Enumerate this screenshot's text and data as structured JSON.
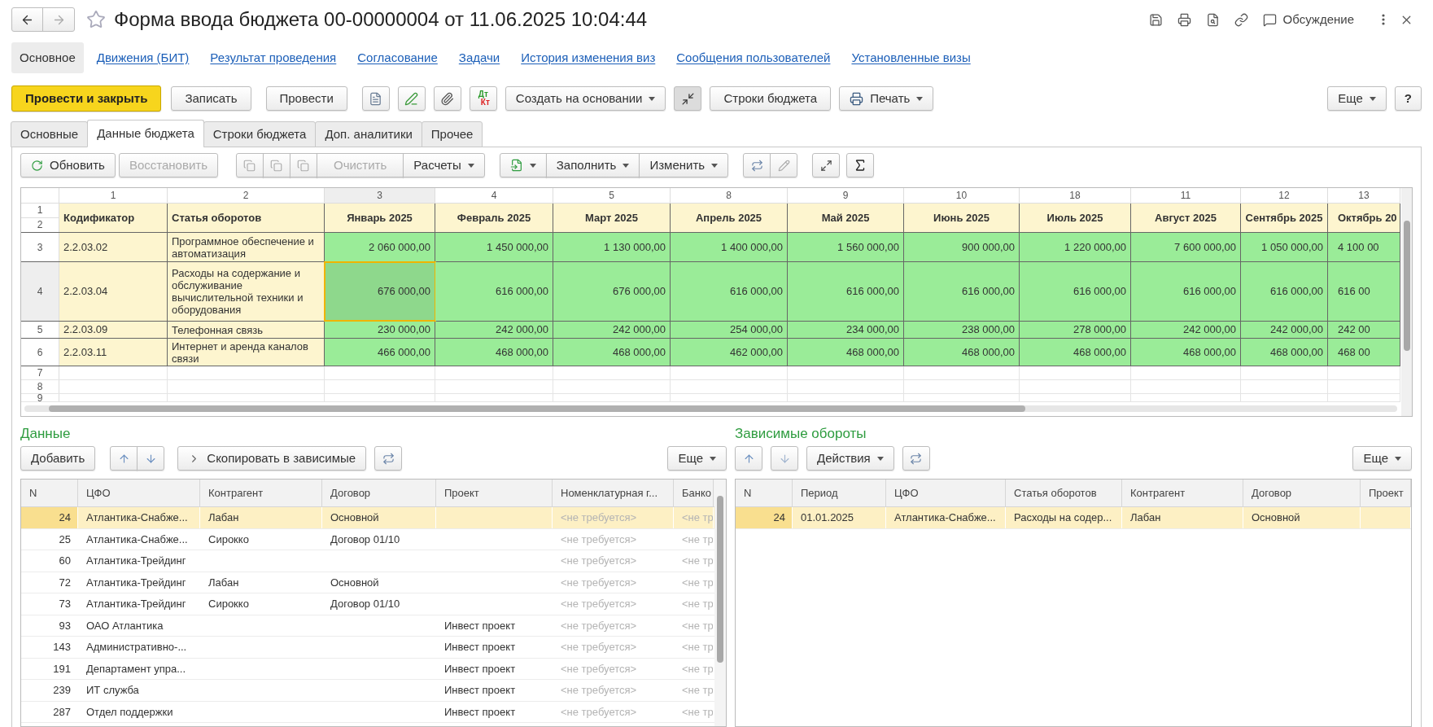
{
  "window": {
    "title": "Форма ввода бюджета 00-00000004 от 11.06.2025 10:04:44",
    "discussion": "Обсуждение"
  },
  "nav_links": [
    {
      "label": "Основное",
      "selected": true
    },
    {
      "label": "Движения (БИТ)",
      "selected": false
    },
    {
      "label": "Результат проведения",
      "selected": false
    },
    {
      "label": "Согласование",
      "selected": false
    },
    {
      "label": "Задачи",
      "selected": false
    },
    {
      "label": "История изменения виз",
      "selected": false
    },
    {
      "label": "Сообщения пользователей",
      "selected": false
    },
    {
      "label": "Установленные визы",
      "selected": false
    }
  ],
  "command_bar": {
    "post_close": "Провести и закрыть",
    "save": "Записать",
    "post": "Провести",
    "debit": "Дт",
    "credit": "Кт",
    "create_based": "Создать на основании",
    "compact_on": true,
    "budget_rows": "Строки бюджета",
    "print": "Печать",
    "more": "Еще",
    "help": "?"
  },
  "tabs": [
    {
      "label": "Основные",
      "selected": false
    },
    {
      "label": "Данные бюджета",
      "selected": true
    },
    {
      "label": "Строки бюджета",
      "selected": false
    },
    {
      "label": "Доп. аналитики",
      "selected": false
    },
    {
      "label": "Прочее",
      "selected": false
    }
  ],
  "sheet_toolbar": {
    "refresh": {
      "label": "Обновить",
      "disabled": false
    },
    "restore": {
      "label": "Восстановить",
      "disabled": true
    },
    "clear": {
      "label": "Очистить",
      "disabled": true
    },
    "calculations": "Расчеты",
    "fill": "Заполнить",
    "change": "Изменить"
  },
  "spreadsheet": {
    "column_numbers": [
      "1",
      "2",
      "3",
      "4",
      "5",
      "8",
      "9",
      "10",
      "18",
      "11",
      "12",
      "13"
    ],
    "header_row_numbers": [
      "1",
      "2"
    ],
    "headers": [
      "Кодификатор",
      "Статья оборотов",
      "Январь 2025",
      "Февраль 2025",
      "Март 2025",
      "Апрель 2025",
      "Май 2025",
      "Июнь 2025",
      "Июль 2025",
      "Август 2025",
      "Сентябрь 2025",
      "Октябрь 20"
    ],
    "rows": [
      {
        "number": "3",
        "code": "2.2.03.02",
        "item": "Программное обеспечение и автоматизация",
        "values": [
          {
            "text": "2 060 000,00",
            "selected": false
          },
          {
            "text": "1 450 000,00",
            "selected": false
          },
          {
            "text": "1 130 000,00",
            "selected": false
          },
          {
            "text": "1 400 000,00",
            "selected": false
          },
          {
            "text": "1 560 000,00",
            "selected": false
          },
          {
            "text": "900 000,00",
            "selected": false
          },
          {
            "text": "1 220 000,00",
            "selected": false
          },
          {
            "text": "7 600 000,00",
            "selected": false
          },
          {
            "text": "1 050 000,00",
            "selected": false
          },
          {
            "text": "4 100 00",
            "selected": false
          }
        ]
      },
      {
        "number": "4",
        "code": "2.2.03.04",
        "item": "Расходы на содержание и обслуживание вычислительной техники и оборудования",
        "values": [
          {
            "text": "676 000,00",
            "selected": true
          },
          {
            "text": "616 000,00",
            "selected": false
          },
          {
            "text": "676 000,00",
            "selected": false
          },
          {
            "text": "616 000,00",
            "selected": false
          },
          {
            "text": "616 000,00",
            "selected": false
          },
          {
            "text": "616 000,00",
            "selected": false
          },
          {
            "text": "616 000,00",
            "selected": false
          },
          {
            "text": "616 000,00",
            "selected": false
          },
          {
            "text": "616 000,00",
            "selected": false
          },
          {
            "text": "616 00",
            "selected": false
          }
        ]
      },
      {
        "number": "5",
        "code": "2.2.03.09",
        "item": "Телефонная связь",
        "values": [
          {
            "text": "230 000,00",
            "selected": false
          },
          {
            "text": "242 000,00",
            "selected": false
          },
          {
            "text": "242 000,00",
            "selected": false
          },
          {
            "text": "254 000,00",
            "selected": false
          },
          {
            "text": "234 000,00",
            "selected": false
          },
          {
            "text": "238 000,00",
            "selected": false
          },
          {
            "text": "278 000,00",
            "selected": false
          },
          {
            "text": "242 000,00",
            "selected": false
          },
          {
            "text": "242 000,00",
            "selected": false
          },
          {
            "text": "242 00",
            "selected": false
          }
        ]
      },
      {
        "number": "6",
        "code": "2.2.03.11",
        "item": "Интернет и аренда каналов связи",
        "values": [
          {
            "text": "466 000,00",
            "selected": false
          },
          {
            "text": "468 000,00",
            "selected": false
          },
          {
            "text": "468 000,00",
            "selected": false
          },
          {
            "text": "462 000,00",
            "selected": false
          },
          {
            "text": "468 000,00",
            "selected": false
          },
          {
            "text": "468 000,00",
            "selected": false
          },
          {
            "text": "468 000,00",
            "selected": false
          },
          {
            "text": "468 000,00",
            "selected": false
          },
          {
            "text": "468 000,00",
            "selected": false
          },
          {
            "text": "468 00",
            "selected": false
          }
        ]
      }
    ],
    "empty_rows": [
      "7",
      "8",
      "9"
    ]
  },
  "data_panel": {
    "title": "Данные",
    "add": "Добавить",
    "copy": "Скопировать в зависимые",
    "more": "Еще",
    "columns": [
      {
        "label": "N",
        "kind": "number"
      },
      {
        "label": "ЦФО",
        "kind": "text"
      },
      {
        "label": "Контрагент",
        "kind": "text"
      },
      {
        "label": "Договор",
        "kind": "text"
      },
      {
        "label": "Проект",
        "kind": "text"
      },
      {
        "label": "Номенклатурная г...",
        "kind": "placeholder"
      },
      {
        "label": "Банко",
        "kind": "placeholder"
      }
    ],
    "rows": [
      {
        "selected": true,
        "cells": [
          "24",
          "Атлантика-Снабже...",
          "Лабан",
          "Основной",
          "",
          "<не требуется>",
          "<не тр"
        ]
      },
      {
        "selected": false,
        "cells": [
          "25",
          "Атлантика-Снабже...",
          "Сирокко",
          "Договор 01/10",
          "",
          "<не требуется>",
          "<не тр"
        ]
      },
      {
        "selected": false,
        "cells": [
          "60",
          "Атлантика-Трейдинг",
          "",
          "",
          "",
          "<не требуется>",
          "<не тр"
        ]
      },
      {
        "selected": false,
        "cells": [
          "72",
          "Атлантика-Трейдинг",
          "Лабан",
          "Основной",
          "",
          "<не требуется>",
          "<не тр"
        ]
      },
      {
        "selected": false,
        "cells": [
          "73",
          "Атлантика-Трейдинг",
          "Сирокко",
          "Договор 01/10",
          "",
          "<не требуется>",
          "<не тр"
        ]
      },
      {
        "selected": false,
        "cells": [
          "93",
          "ОАО Атлантика",
          "",
          "",
          "Инвест проект",
          "<не требуется>",
          "<не тр"
        ]
      },
      {
        "selected": false,
        "cells": [
          "143",
          "Административно-...",
          "",
          "",
          "Инвест проект",
          "<не требуется>",
          "<не тр"
        ]
      },
      {
        "selected": false,
        "cells": [
          "191",
          "Департамент упра...",
          "",
          "",
          "Инвест проект",
          "<не требуется>",
          "<не тр"
        ]
      },
      {
        "selected": false,
        "cells": [
          "239",
          "ИТ служба",
          "",
          "",
          "Инвест проект",
          "<не требуется>",
          "<не тр"
        ]
      },
      {
        "selected": false,
        "cells": [
          "287",
          "Отдел поддержки",
          "",
          "",
          "Инвест проект",
          "<не требуется>",
          "<не тр"
        ]
      }
    ]
  },
  "dependent_panel": {
    "title": "Зависимые обороты",
    "actions": "Действия",
    "more": "Еще",
    "columns": [
      {
        "label": "N",
        "kind": "number"
      },
      {
        "label": "Период",
        "kind": "text"
      },
      {
        "label": "ЦФО",
        "kind": "text"
      },
      {
        "label": "Статья оборотов",
        "kind": "text"
      },
      {
        "label": "Контрагент",
        "kind": "text"
      },
      {
        "label": "Договор",
        "kind": "text"
      },
      {
        "label": "Проект",
        "kind": "text"
      }
    ],
    "rows": [
      {
        "selected": true,
        "cells": [
          "24",
          "01.01.2025",
          "Атлантика-Снабже...",
          "Расходы на содер...",
          "Лабан",
          "Основной",
          ""
        ]
      }
    ]
  }
}
